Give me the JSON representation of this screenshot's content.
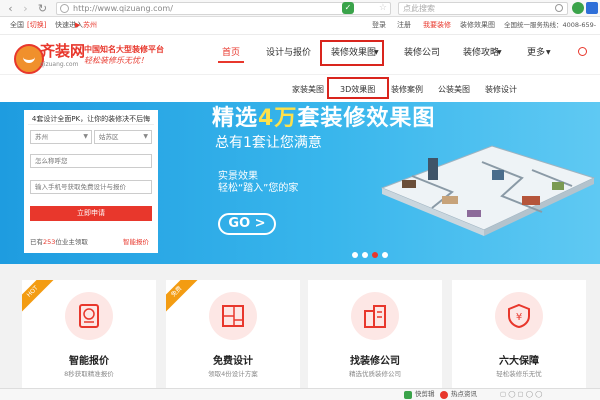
{
  "browser": {
    "url": "http://www.qizuang.com/",
    "search_placeholder": "点此搜索"
  },
  "topbar": {
    "region": "全国",
    "switch": "[切换]",
    "quick_entry": "快速进入",
    "arrow": "▶",
    "city": "苏州",
    "login": "登录",
    "register": "注册",
    "decorate": "我要装修",
    "effect": "装修效果图",
    "hotline": "全国统一服务热线：4008-659-600"
  },
  "logo": {
    "name": "齐装网",
    "domain": "qizuang.com",
    "slogan1": "中国知名大型装修平台",
    "slogan2": "轻松装修乐无忧！"
  },
  "nav": {
    "home": "首页",
    "design": "设计与报价",
    "effect": "装修效果图",
    "company": "装修公司",
    "guide": "装修攻略",
    "more": "更多"
  },
  "subnav": {
    "home_pic": "家装美图",
    "pic3d": "3D效果图",
    "case": "装修案例",
    "office": "公装美图",
    "design": "装修设计"
  },
  "form": {
    "title": "4套设计全面PK，让你的装修决不后悔",
    "city": "苏州",
    "district": "姑苏区",
    "name_placeholder": "怎么称呼您",
    "phone_placeholder": "输入手机号获取免费设计与报价",
    "submit": "立即申请",
    "note_pre": "已有",
    "note_count": "253",
    "note_post": "位业主领取",
    "link": "智能报价"
  },
  "banner": {
    "title_a": "精选",
    "title_hl": "4万",
    "title_b": "套装修效果图",
    "subtitle": "总有1套让您满意",
    "line1": "实景效果",
    "line2": "轻松“踏入”您的家",
    "go": "GO >"
  },
  "features": [
    {
      "title": "智能报价",
      "desc": "8秒获取精准报价",
      "ribbon": "HOT"
    },
    {
      "title": "免费设计",
      "desc": "领取4份设计方案",
      "ribbon": "免费"
    },
    {
      "title": "找装修公司",
      "desc": "精选优质装修公司",
      "ribbon": ""
    },
    {
      "title": "六大保障",
      "desc": "轻松装修乐无忧",
      "ribbon": ""
    }
  ],
  "statusbar": {
    "quick": "快剪辑",
    "news": "热点资讯"
  },
  "colors": {
    "brand": "#e8372c",
    "banner": "#2aa6e8"
  }
}
